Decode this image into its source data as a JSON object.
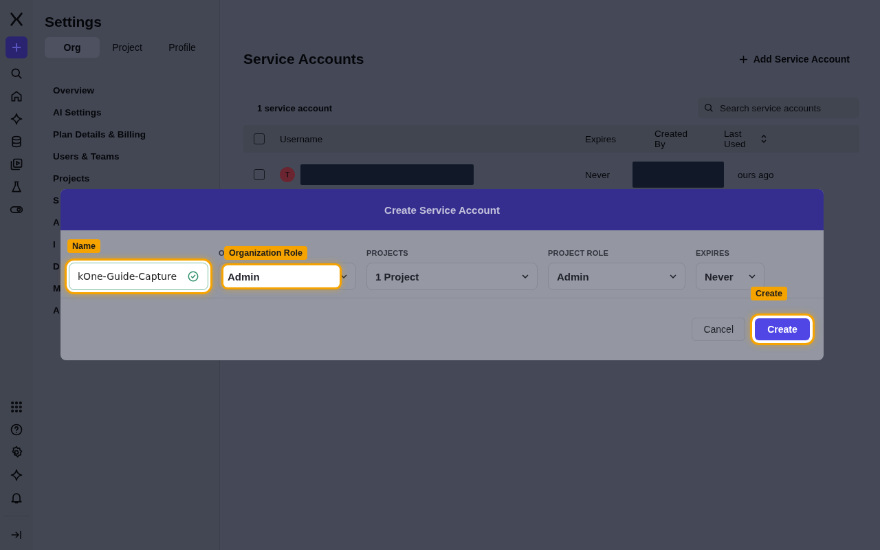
{
  "settings": {
    "title": "Settings",
    "tabs": [
      {
        "label": "Org",
        "selected": true
      },
      {
        "label": "Project",
        "selected": false
      },
      {
        "label": "Profile",
        "selected": false
      }
    ],
    "nav": [
      "Overview",
      "AI Settings",
      "Plan Details & Billing",
      "Users & Teams",
      "Projects",
      "S",
      "A",
      "I",
      "D",
      "M",
      "A"
    ]
  },
  "main": {
    "title": "Service Accounts",
    "add_button": "Add Service Account",
    "count": "1 service account",
    "search": {
      "placeholder": "Search service accounts"
    },
    "columns": [
      "Username",
      "Expires",
      "Created By",
      "Last Used"
    ],
    "header_checked": false,
    "rows": [
      {
        "checked": false,
        "avatar": "T",
        "expires": "Never",
        "last_used": "ours ago"
      }
    ]
  },
  "dialog": {
    "title": "Create Service Account",
    "fields": [
      {
        "kind": "text",
        "value": "kOne-Guide-Capture",
        "callout": "Name"
      },
      {
        "kind": "select",
        "label": "O",
        "value": "Admin",
        "callout": "Organization Role"
      },
      {
        "kind": "select",
        "label": "PROJECTS",
        "value": "1 Project"
      },
      {
        "kind": "select",
        "label": "PROJECT ROLE",
        "value": "Admin"
      },
      {
        "kind": "select",
        "label": "EXPIRES",
        "value": "Never"
      }
    ],
    "buttons": [
      {
        "kind": "secondary",
        "label": "Cancel"
      },
      {
        "kind": "primary",
        "label": "Create",
        "callout": "Create"
      }
    ]
  }
}
